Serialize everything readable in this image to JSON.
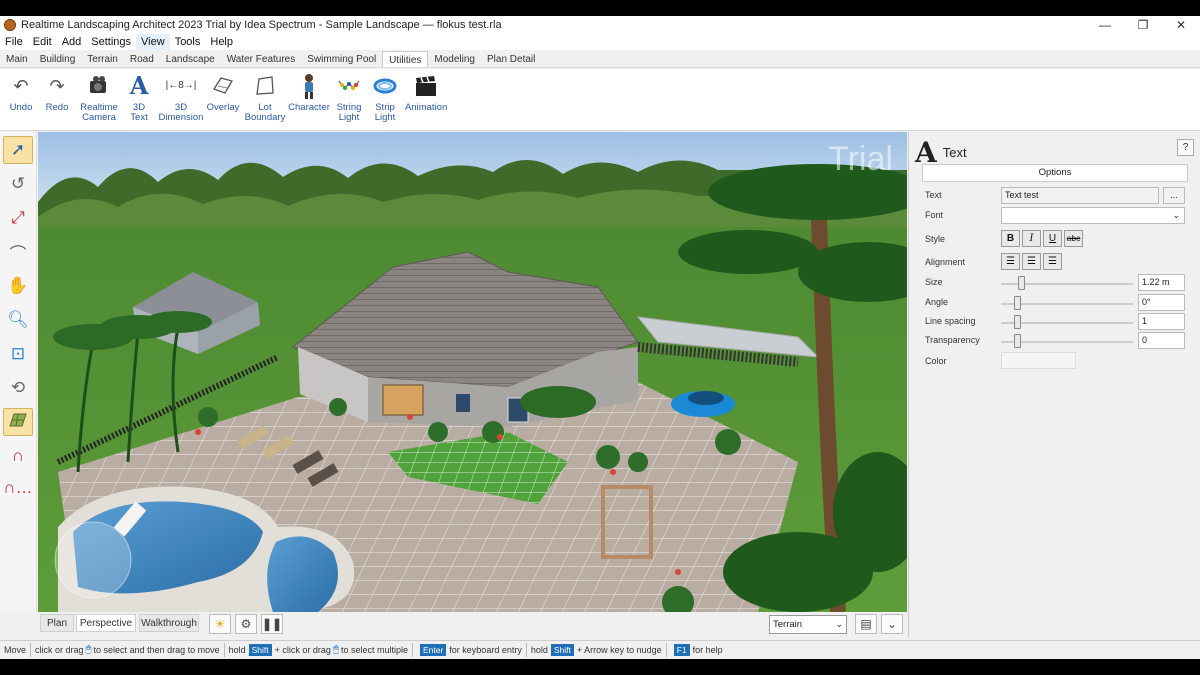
{
  "window": {
    "title": "Realtime Landscaping Architect 2023 Trial by Idea Spectrum - Sample Landscape — flokus test.rla",
    "controls": [
      "—",
      "❐",
      "✕"
    ]
  },
  "menu": [
    "File",
    "Edit",
    "Add",
    "Settings",
    "View",
    "Tools",
    "Help"
  ],
  "tabs": [
    "Main",
    "Building",
    "Terrain",
    "Road",
    "Landscape",
    "Water Features",
    "Swimming Pool",
    "Utilities",
    "Modeling",
    "Plan Detail"
  ],
  "active_tab": "Utilities",
  "ribbon": {
    "undo": "Undo",
    "redo": "Redo",
    "realtime_camera_1": "Realtime",
    "realtime_camera_2": "Camera",
    "text3d_1": "3D",
    "text3d_2": "Text",
    "dimension_1": "3D",
    "dimension_2": "Dimension",
    "overlay": "Overlay",
    "lot_1": "Lot",
    "lot_2": "Boundary",
    "character": "Character",
    "string_1": "String",
    "string_2": "Light",
    "strip_1": "Strip",
    "strip_2": "Light",
    "animation": "Animation"
  },
  "viewport": {
    "watermark": "Trial"
  },
  "view_tabs": [
    "Plan",
    "Perspective",
    "Walkthrough"
  ],
  "active_view": "Perspective",
  "terrain_select": "Terrain",
  "panel": {
    "title": "Text",
    "help": "?",
    "options": "Options",
    "fields": {
      "text_label": "Text",
      "text_value": "Text test",
      "text_more": "...",
      "font_label": "Font",
      "font_value": "",
      "style_label": "Style",
      "alignment_label": "Alignment",
      "size_label": "Size",
      "size_value": "1.22 m",
      "angle_label": "Angle",
      "angle_value": "0°",
      "line_spacing_label": "Line spacing",
      "line_spacing_value": "1",
      "transparency_label": "Transparency",
      "transparency_value": "0",
      "color_label": "Color"
    },
    "style_buttons": [
      "B",
      "I",
      "U",
      "abc"
    ]
  },
  "status": {
    "mode": "Move",
    "t1": "click or drag",
    "t2": "to select and then drag to move",
    "t3": "hold",
    "k_shift": "Shift",
    "t4": "+ click or drag",
    "t5": "to select multiple",
    "k_enter": "Enter",
    "t6": "for keyboard entry",
    "t7": "hold",
    "k_shift2": "Shift",
    "t8": "+ Arrow key to nudge",
    "k_f1": "F1",
    "t9": "for help"
  },
  "colors": {
    "accent": "#1f6fb8",
    "active_tool": "#f8e3a4",
    "grass": "#4f8f35",
    "sky": "#aac8e6"
  }
}
